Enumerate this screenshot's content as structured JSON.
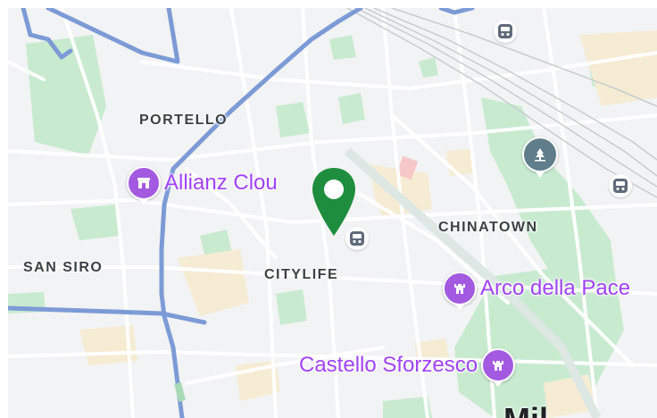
{
  "map": {
    "districts": [
      {
        "id": "portello",
        "label": "PORTELLO"
      },
      {
        "id": "san-siro",
        "label": "SAN SIRO"
      },
      {
        "id": "citylife",
        "label": "CITYLIFE"
      },
      {
        "id": "chinatown",
        "label": "CHINATOWN"
      }
    ],
    "places": {
      "allianz": {
        "label": "Allianz Clou",
        "icon": "building-icon"
      },
      "arco": {
        "label": "Arco della Pace",
        "icon": "castle-icon"
      },
      "castello": {
        "label": "Castello Sforzesco",
        "icon": "castle-icon"
      }
    },
    "park_icon": "tree-icon",
    "transit_icon": "train-icon",
    "pin_color": "#1e8e3e",
    "colors": {
      "background": "#f2f3f4",
      "park": "#c8ebd0",
      "major_road": "#7c9bd6",
      "poi": "#a142f4",
      "poi_badge": "#a35ae0"
    },
    "cutoff_label": "Mil"
  }
}
